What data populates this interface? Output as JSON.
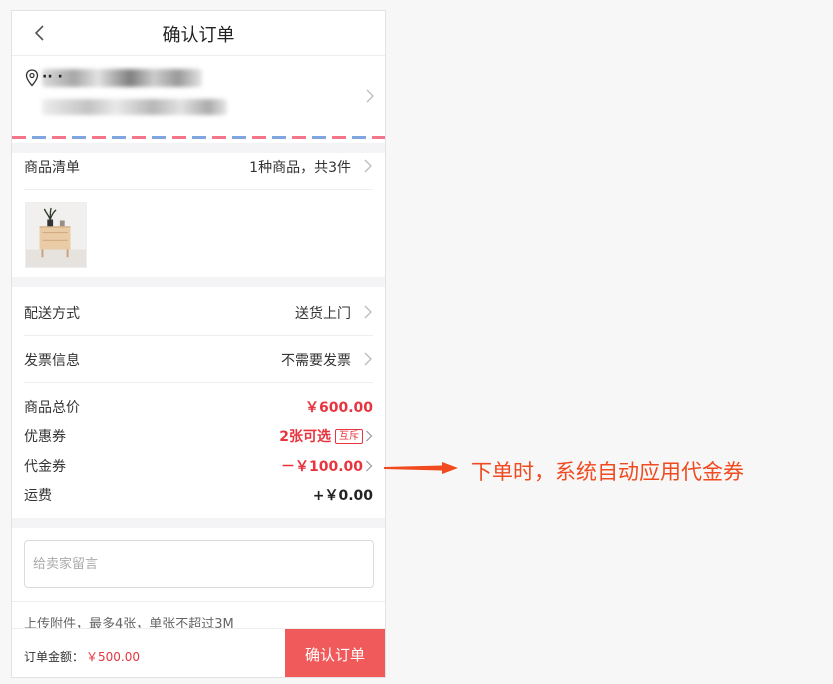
{
  "navbar": {
    "title": "确认订单"
  },
  "address": {
    "line1": "·· ·",
    "line2": ""
  },
  "goods": {
    "label": "商品清单",
    "summary": "1种商品，共3件"
  },
  "delivery": {
    "label": "配送方式",
    "value": "送货上门"
  },
  "invoice": {
    "label": "发票信息",
    "value": "不需要发票"
  },
  "prices": {
    "subtotal_label": "商品总价",
    "subtotal_value": "￥600.00",
    "coupon_label": "优惠券",
    "coupon_value": "2张可选",
    "coupon_tag": "互斥",
    "voucher_label": "代金券",
    "voucher_value": "－￥100.00",
    "shipping_label": "运费",
    "shipping_value": "+￥0.00"
  },
  "message": {
    "placeholder": "给卖家留言"
  },
  "attachment": {
    "note": "上传附件，最多4张，单张不超过3M"
  },
  "footer": {
    "total_label": "订单金额：",
    "total_value": "￥500.00",
    "confirm_label": "确认订单"
  },
  "annotation": {
    "text": "下单时，系统自动应用代金券"
  },
  "colors": {
    "accent_red": "#e8343f",
    "button_red": "#f15a5a",
    "annotation": "#f04a1e"
  }
}
